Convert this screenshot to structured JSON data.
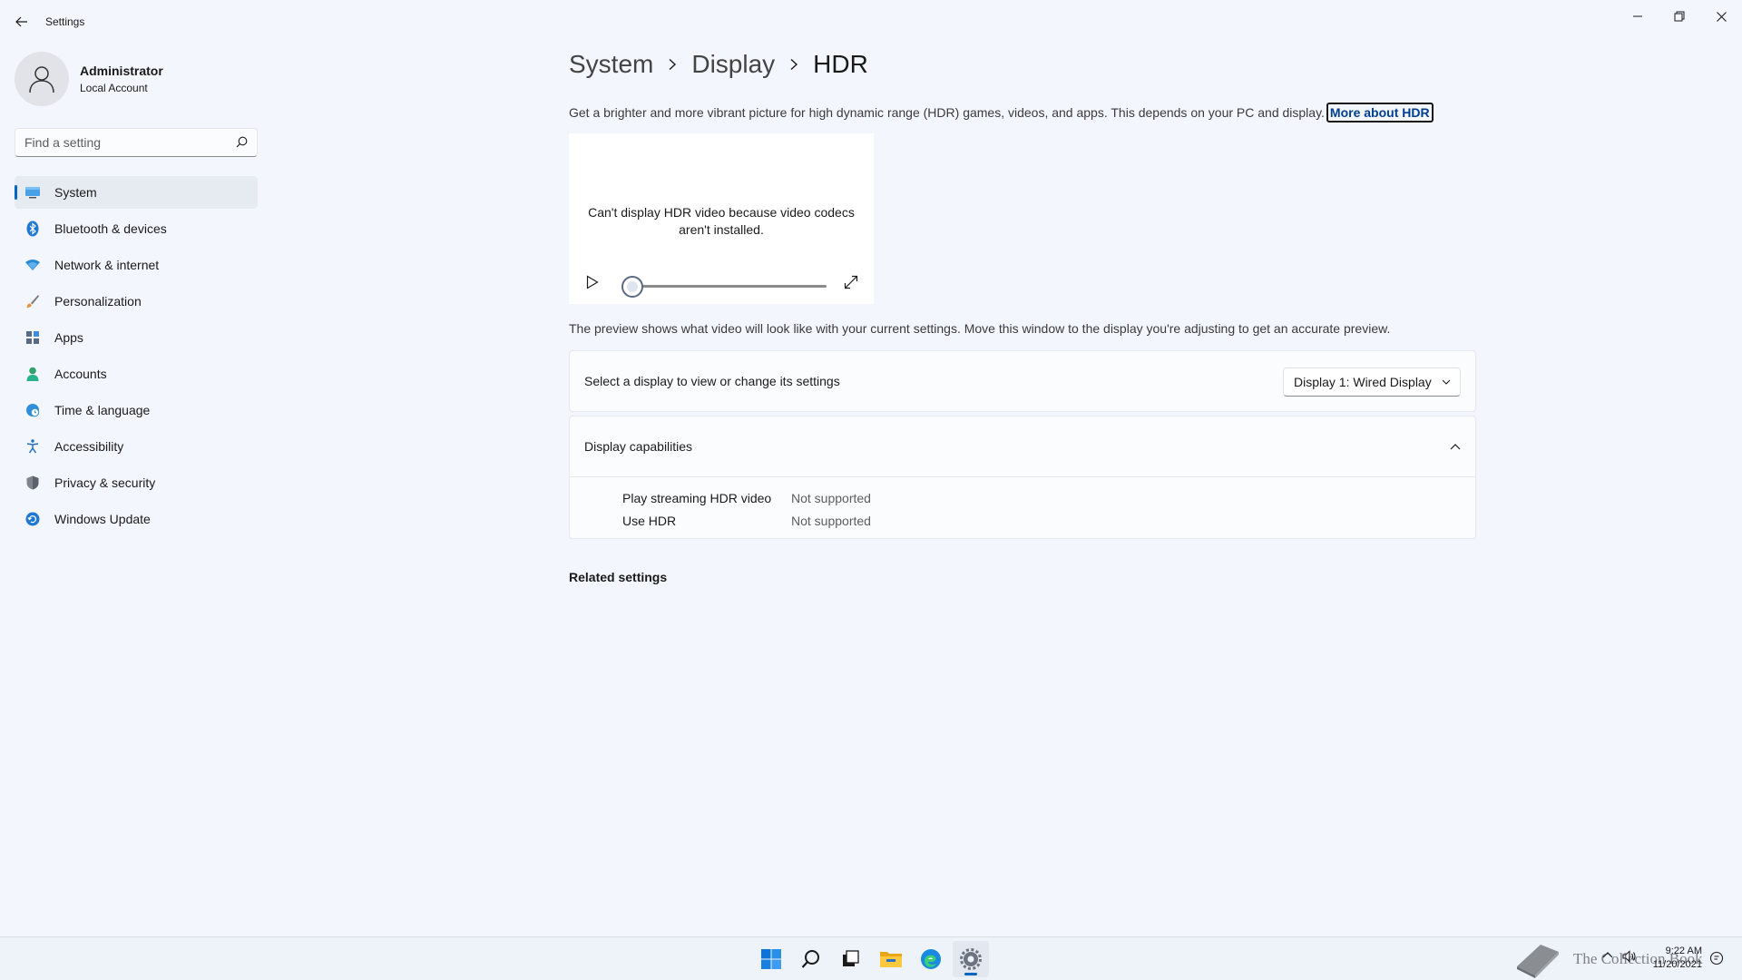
{
  "window": {
    "title": "Settings"
  },
  "profile": {
    "name": "Administrator",
    "account_type": "Local Account"
  },
  "search": {
    "placeholder": "Find a setting"
  },
  "sidebar": {
    "items": [
      {
        "label": "System",
        "icon": "monitor-icon",
        "active": true
      },
      {
        "label": "Bluetooth & devices",
        "icon": "bluetooth-icon"
      },
      {
        "label": "Network & internet",
        "icon": "wifi-icon"
      },
      {
        "label": "Personalization",
        "icon": "brush-icon"
      },
      {
        "label": "Apps",
        "icon": "apps-icon"
      },
      {
        "label": "Accounts",
        "icon": "person-icon"
      },
      {
        "label": "Time & language",
        "icon": "globe-clock-icon"
      },
      {
        "label": "Accessibility",
        "icon": "accessibility-icon"
      },
      {
        "label": "Privacy & security",
        "icon": "shield-icon"
      },
      {
        "label": "Windows Update",
        "icon": "update-icon"
      }
    ]
  },
  "breadcrumb": {
    "items": [
      "System",
      "Display",
      "HDR"
    ]
  },
  "main": {
    "description": "Get a brighter and more vibrant picture for high dynamic range (HDR) games, videos, and apps. This depends on your PC and display.",
    "more_link": "More about HDR",
    "player": {
      "message": "Can't display HDR video because video codecs aren't installed.",
      "progress": 0
    },
    "preview_note": "The preview shows what video will look like with your current settings. Move this window to the display you're adjusting to get an accurate preview.",
    "display_select": {
      "label": "Select a display to view or change its settings",
      "value": "Display 1: Wired Display"
    },
    "capabilities": {
      "title": "Display capabilities",
      "expanded": true,
      "rows": [
        {
          "name": "Play streaming HDR video",
          "value": "Not supported"
        },
        {
          "name": "Use HDR",
          "value": "Not supported"
        }
      ]
    },
    "related": "Related settings"
  },
  "taskbar": {
    "apps": [
      "start-icon",
      "search-icon",
      "task-view-icon",
      "file-explorer-icon",
      "edge-icon",
      "settings-icon"
    ],
    "active_app": "settings-icon",
    "watermark": "The Collection Book",
    "time": "9:22 AM",
    "date": "11/20/2021"
  },
  "colors": {
    "accent": "#0067c0",
    "background": "#f3f6fc"
  }
}
